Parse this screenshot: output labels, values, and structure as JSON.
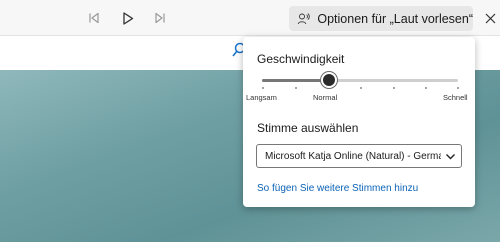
{
  "toolbar": {
    "voice_options_label": "Optionen für „Laut vorlesen“",
    "icons": [
      "previous-icon",
      "play-icon",
      "next-icon",
      "voice-options-icon",
      "close-icon"
    ]
  },
  "panel": {
    "speed_title": "Geschwindigkeit",
    "speed_labels": {
      "slow": "Langsam",
      "normal": "Normal",
      "fast": "Schnell"
    },
    "speed_value_fraction": 0.34,
    "voice_title": "Stimme auswählen",
    "voice_selected": "Microsoft Katja Online (Natural) - German (Germany)",
    "add_voices_link": "So fügen Sie weitere Stimmen hinzu"
  },
  "colors": {
    "link": "#0b63b8",
    "toolbar": "#f7f7f7",
    "voice_button": "#e7e7e7"
  }
}
